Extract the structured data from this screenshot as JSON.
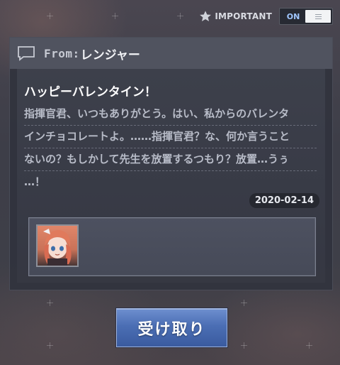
{
  "header": {
    "important_label": "IMPORTANT",
    "toggle_state": "ON"
  },
  "mail": {
    "from_label": "From:",
    "from_name": "レンジャー",
    "subject": "ハッピーバレンタイン！",
    "message_lines": [
      "指揮官君、いつもありがとう。はい、私からのバレンタ",
      "インチョコレートよ。……指揮官君？な、何か言うこと",
      "ないの？もしかして先生を放置するつもり？放置…うぅ",
      "…！"
    ],
    "date": "2020-02-14"
  },
  "actions": {
    "claim_label": "受け取り"
  },
  "colors": {
    "accent_blue": "#4b6eb4",
    "toggle_on_text": "#9fc6ff"
  }
}
